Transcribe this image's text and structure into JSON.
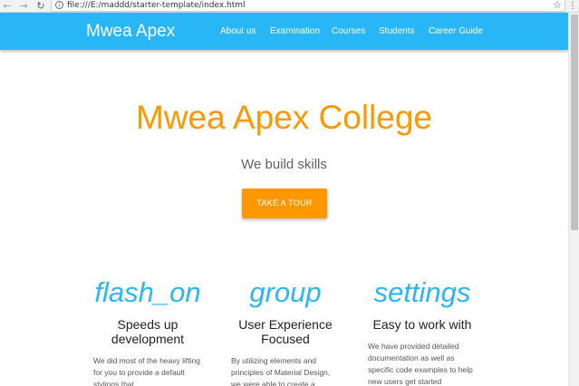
{
  "browser": {
    "url": "file:///E:/maddd/starter-template/index.html",
    "back_icon": "back-arrow-icon",
    "forward_icon": "forward-arrow-icon",
    "reload_icon": "reload-icon",
    "info_icon": "info-icon",
    "star_icon": "star-icon",
    "menu_icon": "kebab-menu-icon"
  },
  "navbar": {
    "brand": "Mwea Apex",
    "links": [
      "About us",
      "Examination",
      "Courses",
      "Students",
      "Career Guide"
    ],
    "color": "#29b6f6"
  },
  "hero": {
    "title": "Mwea Apex College",
    "subtitle": "We build skills",
    "cta_label": "TAKE A TOUR",
    "accent": "#ff9800"
  },
  "features": [
    {
      "icon": "flash_on",
      "title": "Speeds up development",
      "text": "We did most of the heavy lifting for you to provide a default stylings that"
    },
    {
      "icon": "group",
      "title": "User Experience Focused",
      "text": "By utilizing elements and principles of Material Design, we were able to create a"
    },
    {
      "icon": "settings",
      "title": "Easy to work with",
      "text": "We have provided detailed documentation as well as specific code examples to help new users get started"
    }
  ]
}
